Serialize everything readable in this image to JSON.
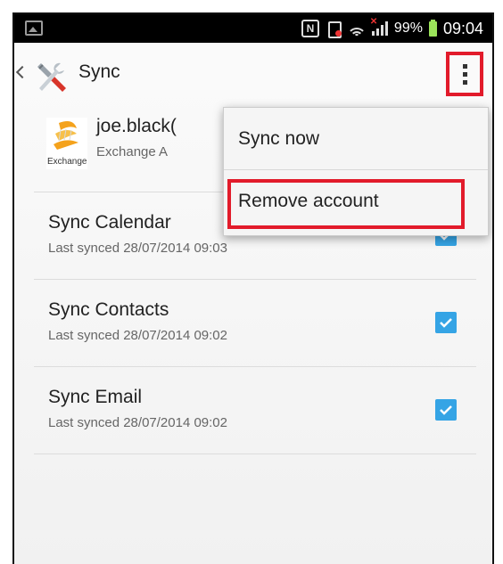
{
  "status_bar": {
    "battery": "99%",
    "time": "09:04",
    "icons": [
      "gallery-icon",
      "nfc-icon",
      "vibrate-icon",
      "wifi-icon",
      "signal-icon",
      "battery-icon"
    ]
  },
  "action_bar": {
    "title": "Sync",
    "icons": [
      "back-chevron-icon",
      "tools-icon",
      "overflow-menu-icon"
    ]
  },
  "account": {
    "name": "joe.black(",
    "type": "Exchange A",
    "logo_text": "Exchange"
  },
  "sync_items": [
    {
      "title": "Sync Calendar",
      "last_synced": "Last synced 28/07/2014 09:03",
      "checked": true
    },
    {
      "title": "Sync Contacts",
      "last_synced": "Last synced 28/07/2014 09:02",
      "checked": true
    },
    {
      "title": "Sync Email",
      "last_synced": "Last synced 28/07/2014 09:02",
      "checked": true
    }
  ],
  "menu": {
    "items": [
      "Sync now",
      "Remove account"
    ]
  },
  "colors": {
    "highlight": "#e21b2b",
    "checkbox": "#35a4e5",
    "battery": "#9be45a"
  }
}
